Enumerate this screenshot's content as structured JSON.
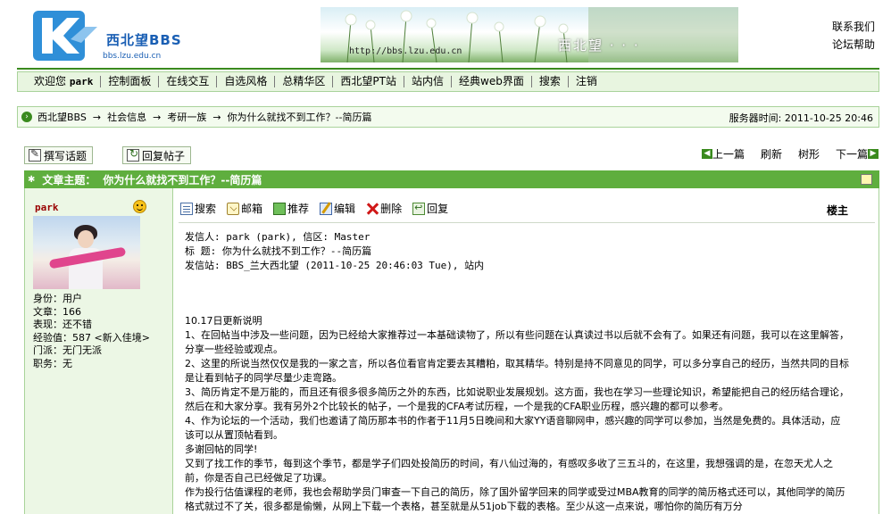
{
  "header": {
    "logo_text": "西北望BBS",
    "logo_url": "bbs.lzu.edu.cn",
    "banner_url": "http://bbs.lzu.edu.cn",
    "banner_title": "西北望 · · ·",
    "top_links": [
      "联系我们",
      "论坛帮助"
    ]
  },
  "nav": {
    "welcome": "欢迎您",
    "user": "park",
    "items": [
      "控制面板",
      "在线交互",
      "自选风格",
      "总精华区",
      "西北望PT站",
      "站内信",
      "经典web界面",
      "搜索",
      "注销"
    ]
  },
  "breadcrumb": {
    "items": [
      "西北望BBS",
      "社会信息",
      "考研一族",
      "你为什么就找不到工作？--简历篇"
    ],
    "separator": "→",
    "server_time": "服务器时间: 2011-10-25 20:46"
  },
  "actions": {
    "new_topic": "撰写话题",
    "reply": "回复帖子",
    "prev": "上一篇",
    "refresh": "刷新",
    "tree": "树形",
    "next": "下一篇"
  },
  "post": {
    "topic_label": "文章主题：",
    "topic_title": "你为什么就找不到工作？--简历篇",
    "floor": "楼主",
    "toolbar": [
      "搜索",
      "邮箱",
      "推荐",
      "编辑",
      "删除",
      "回复"
    ],
    "header_lines": [
      "发信人: park (park), 信区: Master",
      "标  题: 你为什么就找不到工作？--简历篇",
      "发信站: BBS_兰大西北望 (2011-10-25 20:46:03 Tue), 站内"
    ],
    "body": [
      "10.17日更新说明",
      "1、在回帖当中涉及一些问题，因为已经给大家推荐过一本基础读物了，所以有些问题在认真读过书以后就不会有了。如果还有问题，我可以在这里解答，分享一些经验或观点。",
      "2、这里的所说当然仅仅是我的一家之言，所以各位看官肯定要去其糟粕，取其精华。特别是持不同意见的同学，可以多分享自己的经历，当然共同的目标是让看到帖子的同学尽量少走弯路。",
      "3、简历肯定不是万能的，而且还有很多很多简历之外的东西，比如说职业发展规划。这方面，我也在学习一些理论知识，希望能把自己的经历结合理论，然后在和大家分享。我有另外2个比较长的帖子，一个是我的CFA考试历程，一个是我的CFA职业历程，感兴趣的都可以参考。",
      "4、作为论坛的一个活动，我们也邀请了简历那本书的作者于11月5日晚间和大家YY语音聊网申，感兴趣的同学可以参加，当然是免费的。具体活动，应该可以从置顶帖看到。",
      "多谢回帖的同学!",
      "又到了找工作的季节，每到这个季节，都是学子们四处投简历的时间，有八仙过海的，有感叹多收了三五斗的，在这里，我想强调的是，在忽天尤人之前，你是否自己已经做足了功课。",
      "作为投行估值课程的老师，我也会帮助学员门审查一下自己的简历，除了国外留学回来的同学或受过MBA教育的同学的简历格式还可以，其他同学的简历格式就过不了关，很多都是偷懒，从网上下载一个表格，甚至就是从51job下载的表格。至少从这一点来说，哪怕你的简历有万分"
    ]
  },
  "author": {
    "name": "park",
    "info": [
      "身份：用户",
      "文章：166",
      "表现：还不错",
      "经验值：587 <新入佳境>",
      "门派：无门无派",
      "职务：无"
    ]
  },
  "colors": {
    "primary_green": "#5fae3e",
    "nav_bg": "#e8f5e0",
    "sidebar_bg": "#ecf7e5",
    "logo_blue": "#1a5fb4"
  }
}
